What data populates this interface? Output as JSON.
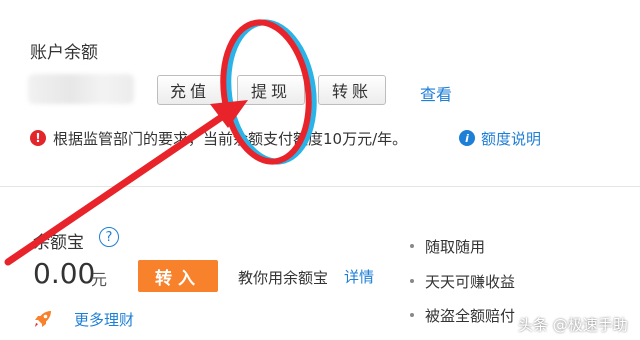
{
  "account": {
    "title": "账户余额",
    "buttons": {
      "charge": "充值",
      "withdraw": "提现",
      "transfer": "转账"
    },
    "view_link": "查看",
    "notice": {
      "icon": "alert-icon",
      "text": "根据监管部门的要求，当前余额支付额度10万元/年。",
      "quota_link": "额度说明"
    }
  },
  "yuebao": {
    "title": "余额宝",
    "amount": "0.00",
    "unit": "元",
    "transfer_in": "转入",
    "teach_text": "教你用余额宝",
    "detail_link": "详情",
    "more_link": "更多理财",
    "features": [
      "随取随用",
      "天天可赚收益",
      "被盗全额赔付"
    ]
  },
  "watermark": "头条 @极速手助",
  "colors": {
    "link": "#1e7fd6",
    "transfer_in_button": "#f7822b",
    "alert": "#e2262b",
    "annotation_red": "#e8232a",
    "annotation_blue": "#2ab3e6"
  }
}
